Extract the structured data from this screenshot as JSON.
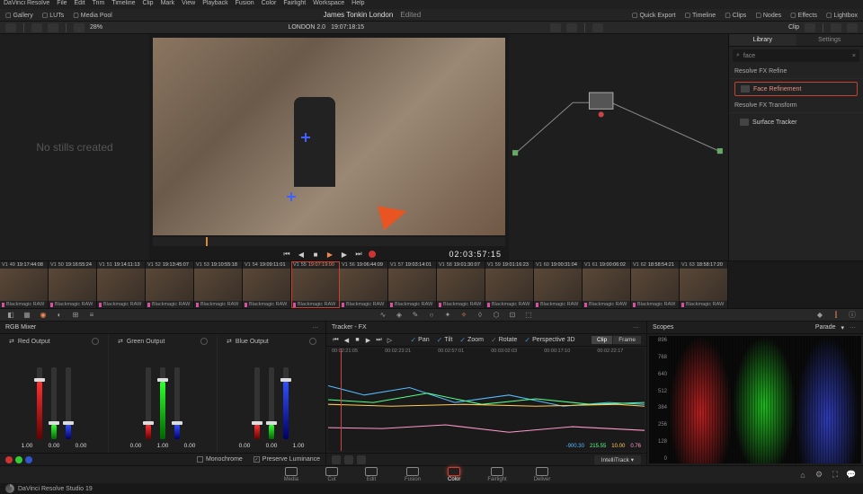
{
  "menu": [
    "DaVinci Resolve",
    "File",
    "Edit",
    "Trim",
    "Timeline",
    "Clip",
    "Mark",
    "View",
    "Playback",
    "Fusion",
    "Color",
    "Fairlight",
    "Workspace",
    "Help"
  ],
  "topbar": {
    "left": [
      {
        "label": "Gallery"
      },
      {
        "label": "LUTs"
      },
      {
        "label": "Media Pool"
      }
    ],
    "title": "James Tonkin London",
    "edited": "Edited",
    "right": [
      {
        "label": "Quick Export",
        "icon": "export"
      },
      {
        "label": "Timeline",
        "icon": "timeline"
      },
      {
        "label": "Clips",
        "icon": "clips"
      },
      {
        "label": "Nodes",
        "icon": "nodes"
      },
      {
        "label": "Effects",
        "icon": "effects"
      },
      {
        "label": "Lightbox",
        "icon": "lightbox"
      }
    ]
  },
  "toolbar2": {
    "zoom": "28%",
    "timeline_name": "LONDON 2.0",
    "viewer_tc": "19:07:18:15",
    "clip_label": "Clip"
  },
  "gallery": {
    "empty": "No stills created"
  },
  "viewer": {
    "tc": "02:03:57:15"
  },
  "side": {
    "tabs": [
      "Library",
      "Settings"
    ],
    "search_placeholder": "face",
    "sections": [
      {
        "title": "Resolve FX Refine",
        "items": [
          {
            "label": "Face Refinement",
            "selected": true
          }
        ]
      },
      {
        "title": "Resolve FX Transform",
        "items": [
          {
            "label": "Surface Tracker"
          }
        ]
      }
    ]
  },
  "thumbs": [
    {
      "n": "49",
      "tc": "19:17:44:08",
      "fmt": "Blackmagic RAW"
    },
    {
      "n": "50",
      "tc": "19:16:55:24",
      "fmt": "Blackmagic RAW"
    },
    {
      "n": "51",
      "tc": "19:14:11:13",
      "fmt": "Blackmagic RAW"
    },
    {
      "n": "52",
      "tc": "19:13:45:07",
      "fmt": "Blackmagic RAW"
    },
    {
      "n": "53",
      "tc": "19:10:55:18",
      "fmt": "Blackmagic RAW"
    },
    {
      "n": "54",
      "tc": "19:09:11:01",
      "fmt": "Blackmagic RAW"
    },
    {
      "n": "55",
      "tc": "19:07:19:00",
      "fmt": "Blackmagic RAW",
      "sel": true
    },
    {
      "n": "56",
      "tc": "19:06:44:09",
      "fmt": "Blackmagic RAW"
    },
    {
      "n": "57",
      "tc": "19:03:14:01",
      "fmt": "Blackmagic RAW"
    },
    {
      "n": "58",
      "tc": "19:01:30:07",
      "fmt": "Blackmagic RAW"
    },
    {
      "n": "59",
      "tc": "19:01:16:23",
      "fmt": "Blackmagic RAW"
    },
    {
      "n": "60",
      "tc": "19:00:31:04",
      "fmt": "Blackmagic RAW"
    },
    {
      "n": "61",
      "tc": "19:00:06:02",
      "fmt": "Blackmagic RAW"
    },
    {
      "n": "62",
      "tc": "18:58:54:21",
      "fmt": "Blackmagic RAW"
    },
    {
      "n": "63",
      "tc": "18:58:17:20",
      "fmt": "Blackmagic RAW"
    }
  ],
  "mixer": {
    "title": "RGB Mixer",
    "cols": [
      {
        "name": "Red Output",
        "vals": [
          "1.00",
          "0.00",
          "0.00"
        ],
        "heights": [
          80,
          20,
          20
        ]
      },
      {
        "name": "Green Output",
        "vals": [
          "0.00",
          "1.00",
          "0.00"
        ],
        "heights": [
          20,
          80,
          20
        ]
      },
      {
        "name": "Blue Output",
        "vals": [
          "0.00",
          "0.00",
          "1.00"
        ],
        "heights": [
          20,
          20,
          80
        ]
      }
    ],
    "mono": "Monochrome",
    "preserve": "Preserve Luminance"
  },
  "tracker": {
    "title": "Tracker - FX",
    "checks": [
      {
        "l": "Pan",
        "on": true
      },
      {
        "l": "Tilt",
        "on": true
      },
      {
        "l": "Zoom",
        "on": true
      },
      {
        "l": "Rotate",
        "on": false
      },
      {
        "l": "Perspective 3D",
        "on": true
      }
    ],
    "modes": [
      "Clip",
      "Frame"
    ],
    "timecodes": [
      "00:02:21:05",
      "00:02:23:21",
      "00:02:57:01",
      "00:03:02:03",
      "00:00:17:10",
      "00:02:22:17"
    ],
    "readout": [
      "-900.30",
      "215.55",
      "10.00",
      "0.76"
    ],
    "intellitrack": "IntelliTrack"
  },
  "scopes": {
    "title": "Scopes",
    "mode": "Parade",
    "ticks": [
      "896",
      "768",
      "640",
      "512",
      "384",
      "256",
      "128",
      "0"
    ]
  },
  "pages": [
    "Media",
    "Cut",
    "Edit",
    "Fusion",
    "Color",
    "Fairlight",
    "Deliver"
  ],
  "status": "DaVinci Resolve Studio 19"
}
